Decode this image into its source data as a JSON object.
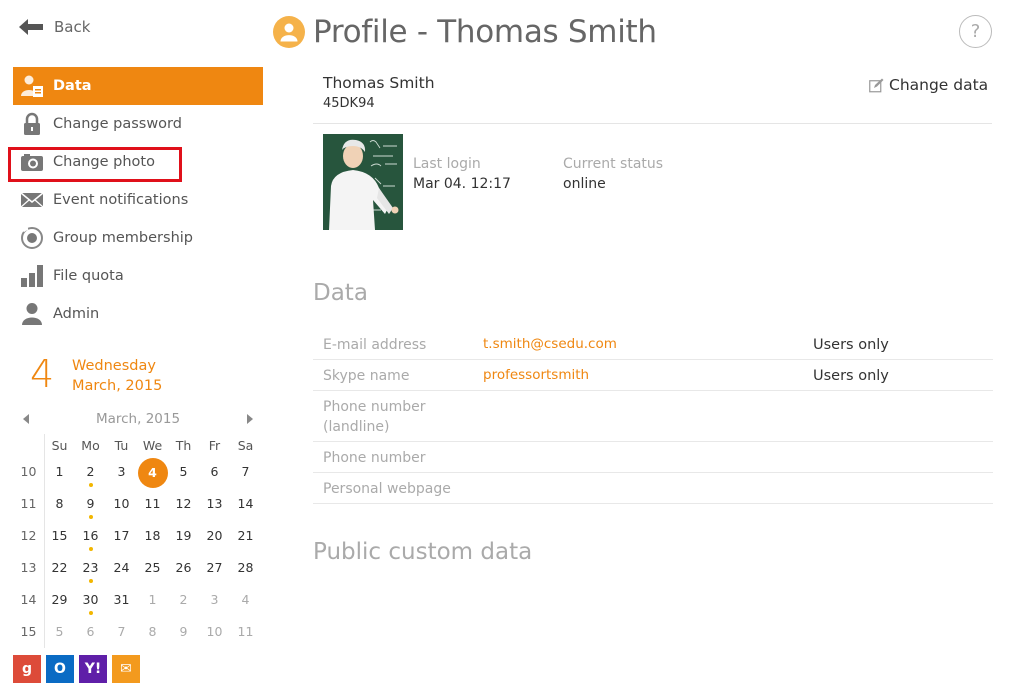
{
  "nav": {
    "back_label": "Back"
  },
  "menu": [
    {
      "label": "Data",
      "icon": "user-data-icon",
      "active": true
    },
    {
      "label": "Change password",
      "icon": "lock-icon",
      "active": false
    },
    {
      "label": "Change photo",
      "icon": "camera-icon",
      "active": false
    },
    {
      "label": "Event notifications",
      "icon": "envelope-icon",
      "active": false
    },
    {
      "label": "Group membership",
      "icon": "target-icon",
      "active": false
    },
    {
      "label": "File quota",
      "icon": "bar-chart-icon",
      "active": false
    },
    {
      "label": "Admin",
      "icon": "person-icon",
      "active": false
    }
  ],
  "date": {
    "day": "4",
    "weekday": "Wednesday",
    "month_year": "March, 2015"
  },
  "calendar": {
    "title": "March, 2015",
    "weekdays": [
      "Su",
      "Mo",
      "Tu",
      "We",
      "Th",
      "Fr",
      "Sa"
    ],
    "weeks": [
      {
        "wk": "10",
        "days": [
          "1",
          "2",
          "3",
          "4",
          "5",
          "6",
          "7"
        ]
      },
      {
        "wk": "11",
        "days": [
          "8",
          "9",
          "10",
          "11",
          "12",
          "13",
          "14"
        ]
      },
      {
        "wk": "12",
        "days": [
          "15",
          "16",
          "17",
          "18",
          "19",
          "20",
          "21"
        ]
      },
      {
        "wk": "13",
        "days": [
          "22",
          "23",
          "24",
          "25",
          "26",
          "27",
          "28"
        ]
      },
      {
        "wk": "14",
        "days": [
          "29",
          "30",
          "31",
          "1",
          "2",
          "3",
          "4"
        ]
      },
      {
        "wk": "15",
        "days": [
          "5",
          "6",
          "7",
          "8",
          "9",
          "10",
          "11"
        ]
      }
    ]
  },
  "apps": [
    {
      "name": "google-icon",
      "glyph": "g",
      "color": "#dd4b39"
    },
    {
      "name": "outlook-icon",
      "glyph": "O",
      "color": "#0a6bc4"
    },
    {
      "name": "yahoo-icon",
      "glyph": "Y!",
      "color": "#5f1fa8"
    },
    {
      "name": "mail-icon",
      "glyph": "✉",
      "color": "#f39a1e"
    }
  ],
  "header": {
    "title": "Profile - Thomas Smith",
    "help": "?"
  },
  "profile": {
    "name": "Thomas Smith",
    "id": "45DK94",
    "change_data_label": "Change data",
    "last_login_label": "Last login",
    "last_login_value": "Mar 04. 12:17",
    "status_label": "Current status",
    "status_value": "online"
  },
  "data_section": {
    "title": "Data",
    "rows": [
      {
        "label": "E-mail address",
        "value": "t.smith@csedu.com",
        "privacy": "Users only"
      },
      {
        "label": "Skype name",
        "value": "professortsmith",
        "privacy": "Users only"
      },
      {
        "label": "Phone number (landline)",
        "value": "",
        "privacy": ""
      },
      {
        "label": "Phone number",
        "value": "",
        "privacy": ""
      },
      {
        "label": "Personal webpage",
        "value": "",
        "privacy": ""
      }
    ]
  },
  "custom_section": {
    "title": "Public custom data"
  },
  "colors": {
    "accent": "#ef8711",
    "dot": "#f2b600",
    "highlight": "#e0101a"
  }
}
